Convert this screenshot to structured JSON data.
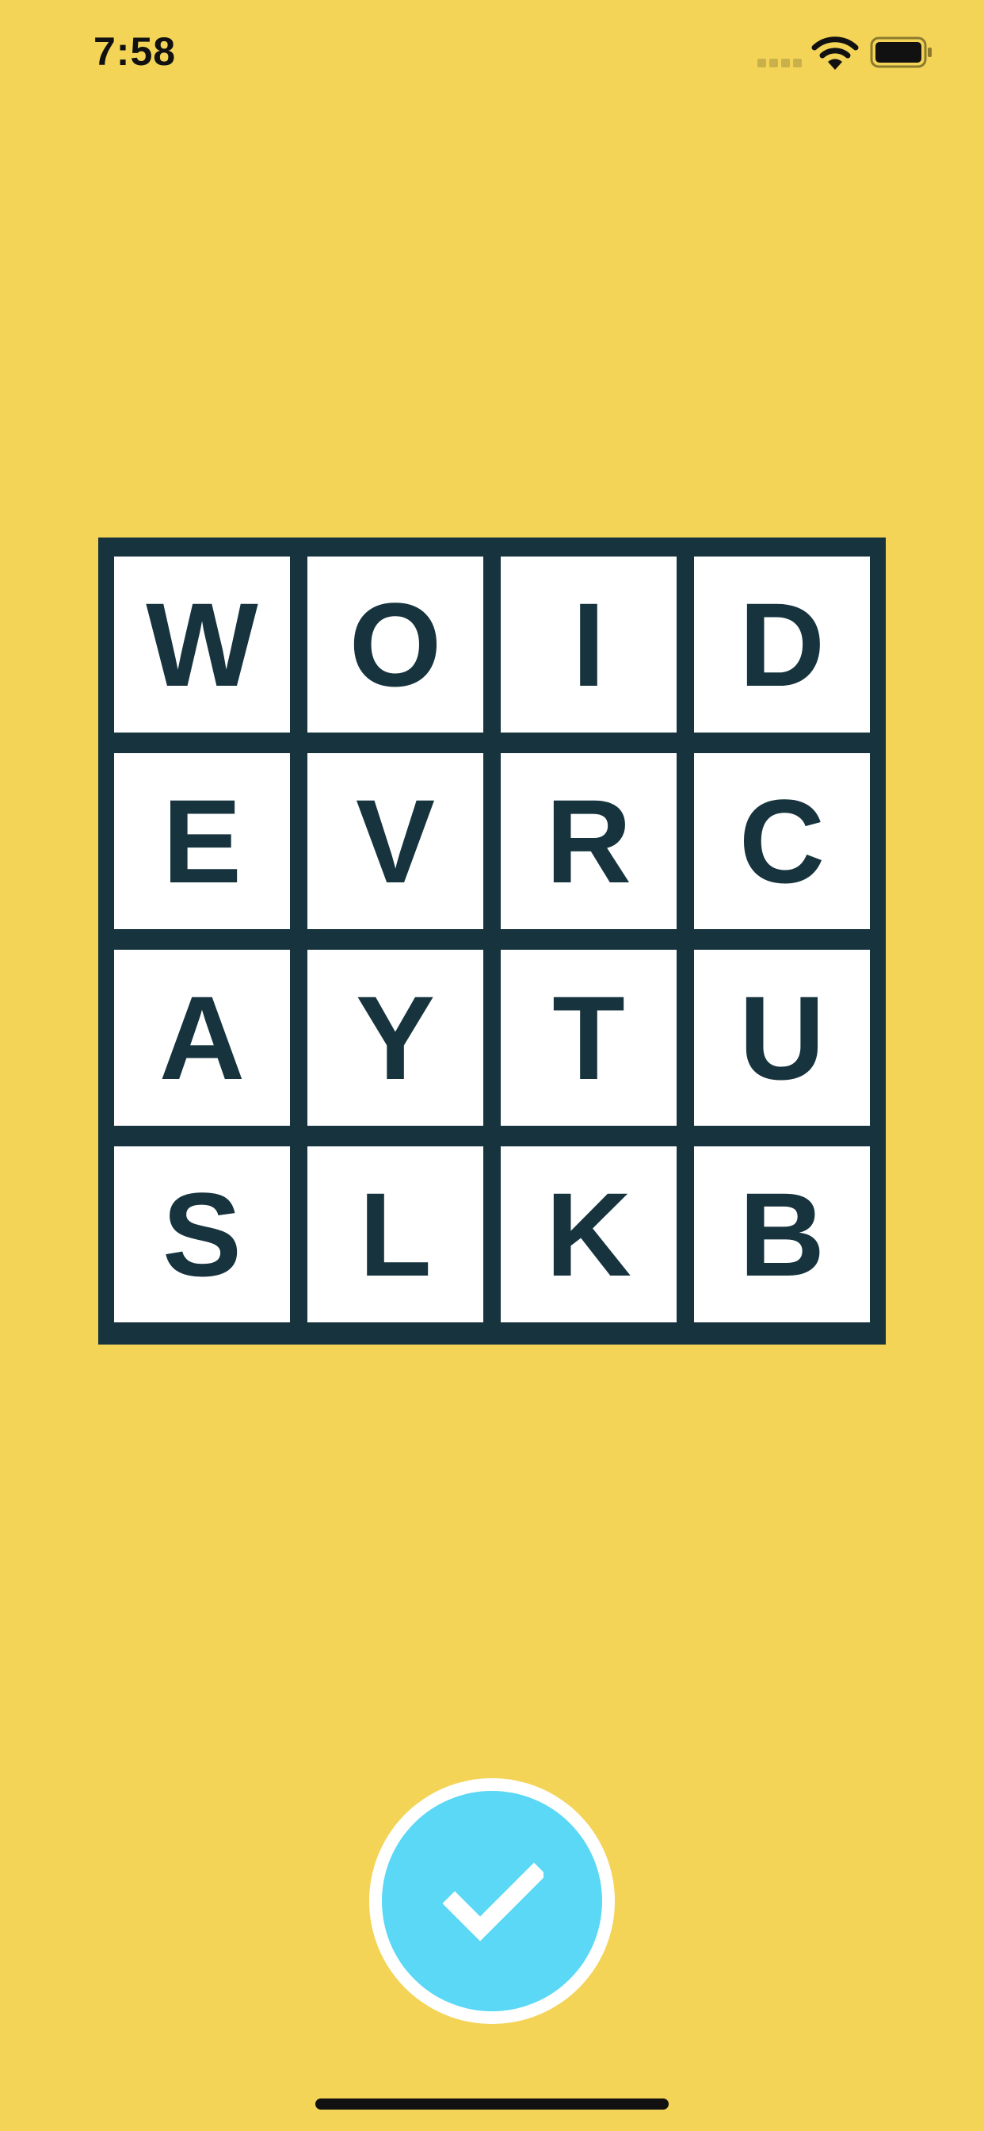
{
  "status_bar": {
    "time": "7:58",
    "icons": [
      "signal-dots-icon",
      "wifi-icon",
      "battery-icon"
    ]
  },
  "board": {
    "rows": [
      [
        "W",
        "O",
        "I",
        "D"
      ],
      [
        "E",
        "V",
        "R",
        "C"
      ],
      [
        "A",
        "Y",
        "T",
        "U"
      ],
      [
        "S",
        "L",
        "K",
        "B"
      ]
    ]
  },
  "submit": {
    "icon": "checkmark-icon"
  },
  "colors": {
    "background": "#F3D457",
    "board_frame": "#17343E",
    "tile": "#FFFFFF",
    "letter": "#17343E",
    "submit_button": "#5AD8F5"
  }
}
